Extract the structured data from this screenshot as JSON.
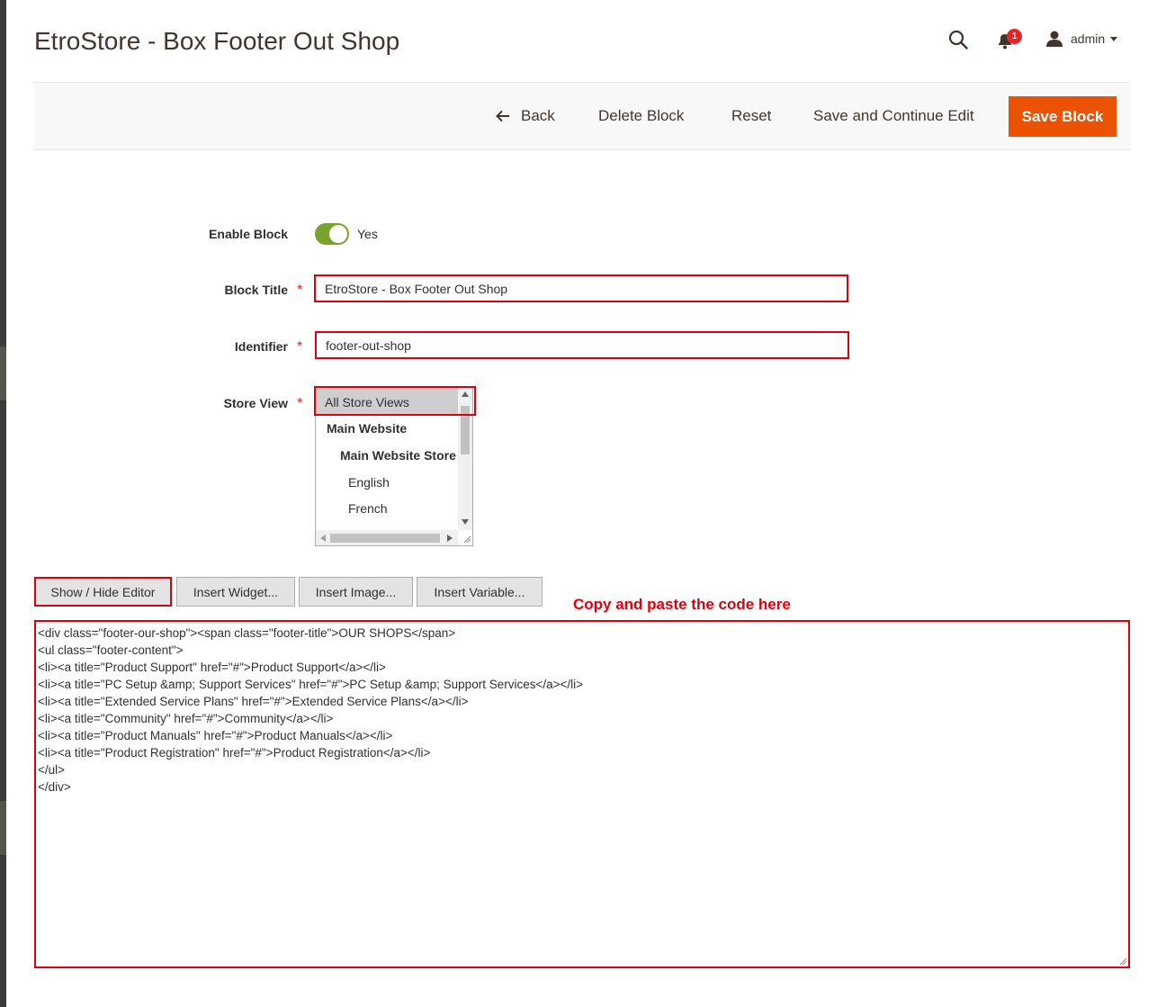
{
  "page": {
    "title": "EtroStore - Box Footer Out Shop"
  },
  "header": {
    "notification_count": "1",
    "user_name": "admin"
  },
  "toolbar": {
    "back_label": "Back",
    "delete_label": "Delete Block",
    "reset_label": "Reset",
    "save_continue_label": "Save and Continue Edit",
    "save_label": "Save Block"
  },
  "form": {
    "enable_block": {
      "label": "Enable Block",
      "value_text": "Yes",
      "on": true
    },
    "block_title": {
      "label": "Block Title",
      "value": "EtroStore - Box Footer Out Shop"
    },
    "identifier": {
      "label": "Identifier",
      "value": "footer-out-shop"
    },
    "store_view": {
      "label": "Store View",
      "options": [
        "All Store Views",
        "Main Website",
        "Main Website Store",
        "English",
        "French"
      ],
      "selected": "All Store Views"
    }
  },
  "editor": {
    "buttons": [
      "Show / Hide Editor",
      "Insert Widget...",
      "Insert Image...",
      "Insert Variable..."
    ],
    "annotation": "Copy and paste the code here",
    "code_lines": [
      "<div class=\"footer-our-shop\"><span class=\"footer-title\">OUR SHOPS</span>",
      "<ul class=\"footer-content\">",
      "<li><a title=\"Product Support\" href=\"#\">Product Support</a></li>",
      "<li><a title=\"PC Setup &amp; Support Services\" href=\"#\">PC Setup &amp; Support Services</a></li>",
      "<li><a title=\"Extended Service Plans\" href=\"#\">Extended Service Plans</a></li>",
      "<li><a title=\"Community\" href=\"#\">Community</a></li>",
      "<li><a title=\"Product Manuals\" href=\"#\">Product Manuals</a></li>",
      "<li><a title=\"Product Registration\" href=\"#\">Product Registration</a></li>",
      "</ul>",
      "</div>"
    ]
  },
  "colors": {
    "primary_button": "#eb5202",
    "toggle_on": "#79a22e",
    "highlight_border": "#e0000c",
    "badge": "#e22626"
  },
  "icons": [
    "search-icon",
    "bell-icon",
    "user-icon",
    "back-arrow-icon",
    "chevron-down-icon"
  ]
}
